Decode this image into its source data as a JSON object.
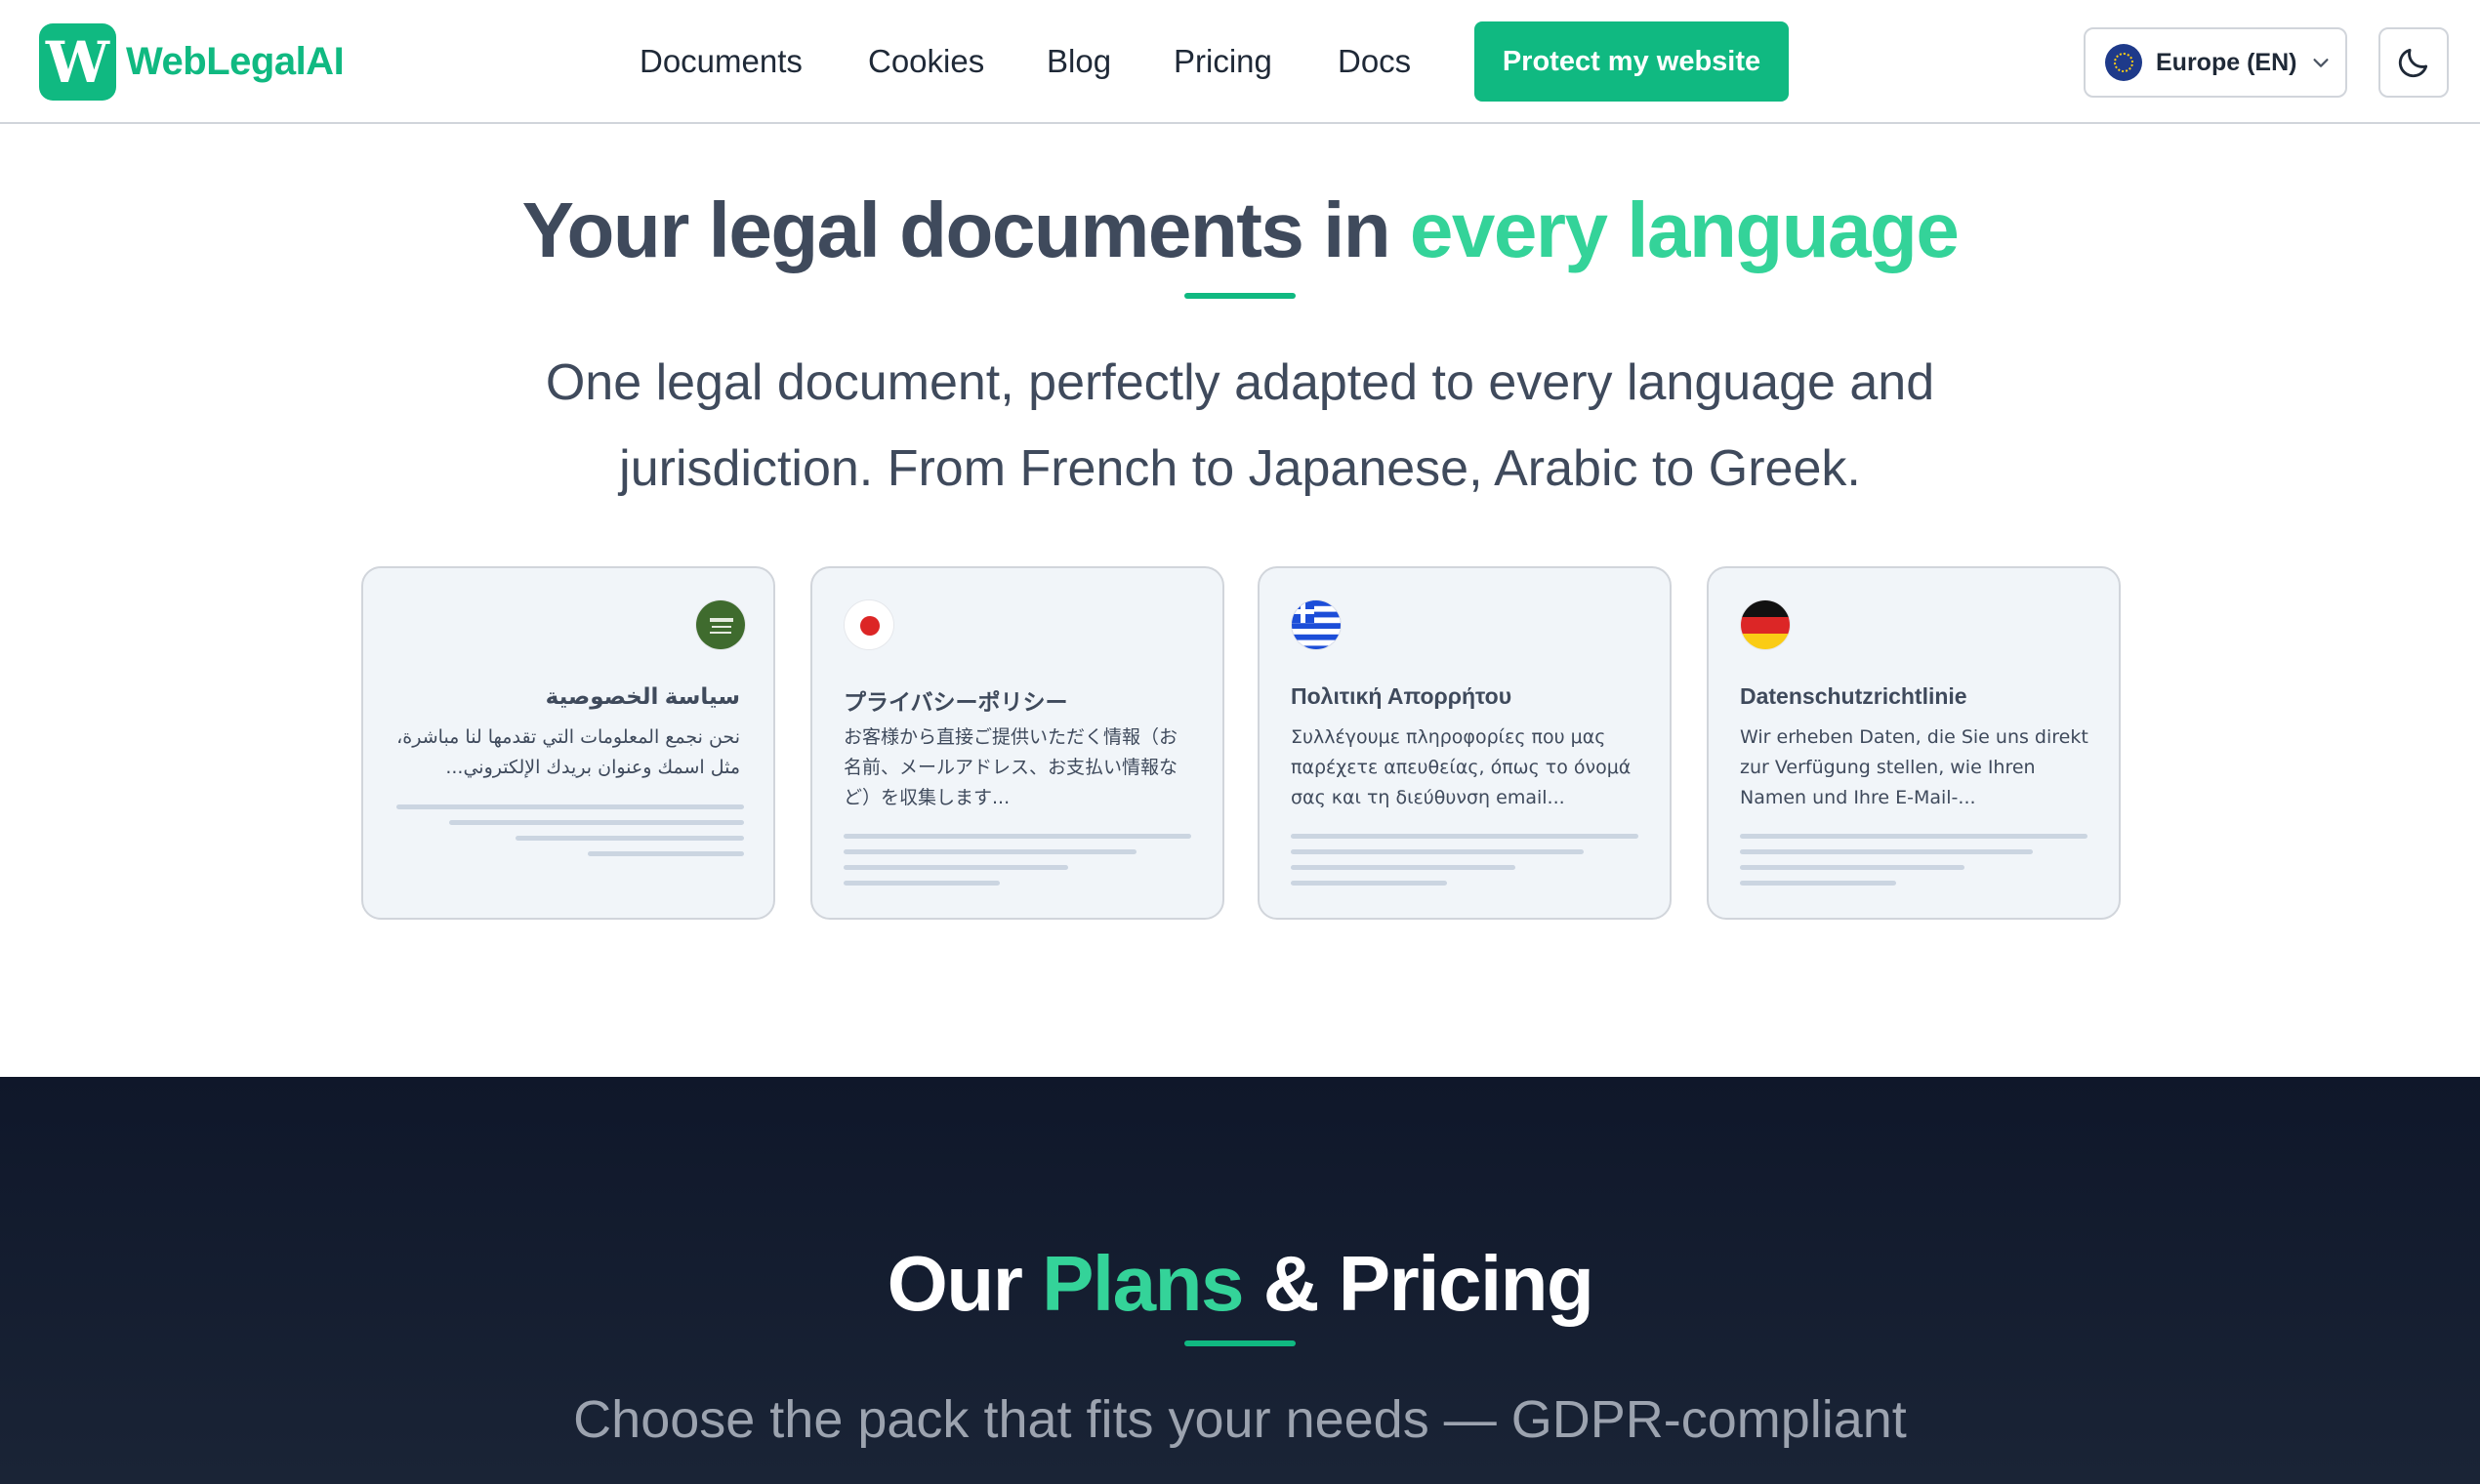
{
  "brand": {
    "logo_letter": "W",
    "name": "WebLegalAI",
    "color": "#10b981"
  },
  "nav": {
    "items": [
      "Documents",
      "Cookies",
      "Blog",
      "Pricing",
      "Docs"
    ],
    "cta_label": "Protect my website"
  },
  "region": {
    "label": "Europe (EN)",
    "flag_icon": "eu-flag-icon"
  },
  "theme_toggle": {
    "icon": "moon-icon"
  },
  "hero": {
    "title_main": "Your legal documents in",
    "title_accent": "every language",
    "subtitle": "One legal document, perfectly adapted to every language and jurisdiction. From French to Japanese, Arabic to Greek."
  },
  "cards": [
    {
      "lang": "ar",
      "flag_icon": "saudi-arabia-flag-icon",
      "title": "سياسة الخصوصية",
      "text": "نحن نجمع المعلومات التي تقدمها لنا مباشرة، مثل اسمك وعنوان بريدك الإلكتروني..."
    },
    {
      "lang": "ja",
      "flag_icon": "japan-flag-icon",
      "title": "プライバシーポリシー",
      "text": "お客様から直接ご提供いただく情報（お名前、メールアドレス、お支払い情報など）を収集します..."
    },
    {
      "lang": "el",
      "flag_icon": "greece-flag-icon",
      "title": "Πολιτική Απορρήτου",
      "text": "Συλλέγουμε πληροφορίες που μας παρέχετε απευθείας, όπως το όνομά σας και τη διεύθυνση email..."
    },
    {
      "lang": "de",
      "flag_icon": "germany-flag-icon",
      "title": "Datenschutzrichtlinie",
      "text": "Wir erheben Daten, die Sie uns direkt zur Verfügung stellen, wie Ihren Namen und Ihre E-Mail-..."
    }
  ],
  "pricing": {
    "title_pre": "Our",
    "title_accent": "Plans",
    "title_post": "& Pricing",
    "subtitle": "Choose the pack that fits your needs — GDPR-compliant"
  }
}
